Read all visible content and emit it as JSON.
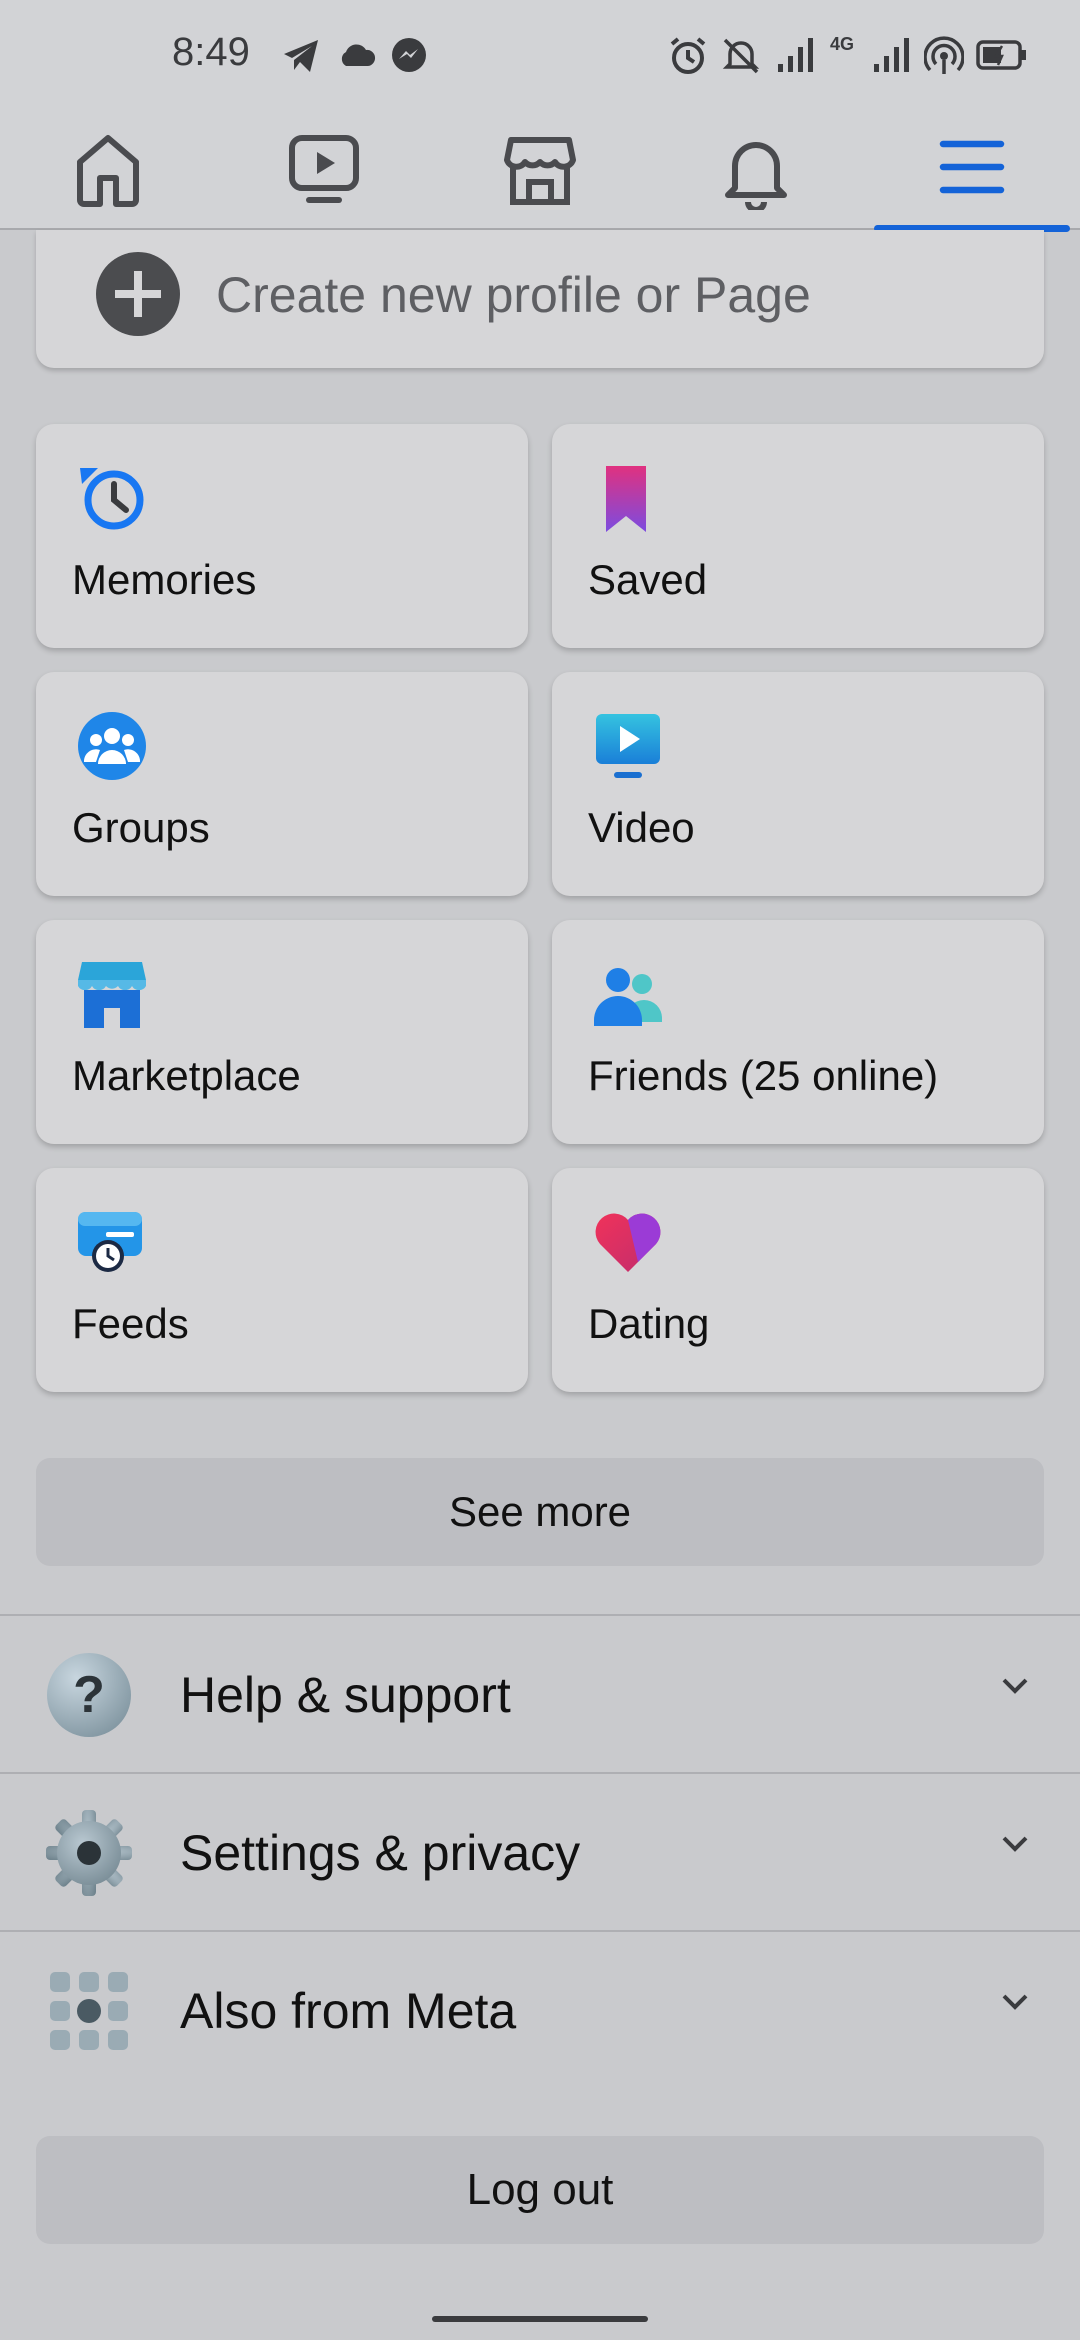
{
  "status_bar": {
    "time": "8:49",
    "network": "4G",
    "icons_left": [
      "telegram-icon",
      "cloud-icon",
      "messenger-icon"
    ],
    "icons_right": [
      "alarm-icon",
      "mute-icon",
      "signal-icon",
      "signal-icon",
      "hotspot-icon",
      "battery-icon"
    ]
  },
  "nav": {
    "tabs": [
      {
        "name": "home",
        "icon": "home-icon"
      },
      {
        "name": "video",
        "icon": "video-icon"
      },
      {
        "name": "marketplace",
        "icon": "marketplace-icon"
      },
      {
        "name": "notifications",
        "icon": "bell-icon"
      },
      {
        "name": "menu",
        "icon": "menu-icon",
        "active": true
      }
    ],
    "active_color": "#1463d8"
  },
  "create": {
    "label": "Create new profile or Page"
  },
  "shortcuts": [
    {
      "label": "Memories",
      "icon": "memories-icon"
    },
    {
      "label": "Saved",
      "icon": "saved-icon"
    },
    {
      "label": "Groups",
      "icon": "groups-icon"
    },
    {
      "label": "Video",
      "icon": "video-icon"
    },
    {
      "label": "Marketplace",
      "icon": "marketplace-icon"
    },
    {
      "label": "Friends (25 online)",
      "icon": "friends-icon"
    },
    {
      "label": "Feeds",
      "icon": "feeds-icon"
    },
    {
      "label": "Dating",
      "icon": "dating-icon"
    }
  ],
  "see_more": "See more",
  "sections": [
    {
      "label": "Help & support",
      "icon": "help-icon"
    },
    {
      "label": "Settings & privacy",
      "icon": "gear-icon"
    },
    {
      "label": "Also from Meta",
      "icon": "meta-apps-icon"
    }
  ],
  "logout": "Log out"
}
